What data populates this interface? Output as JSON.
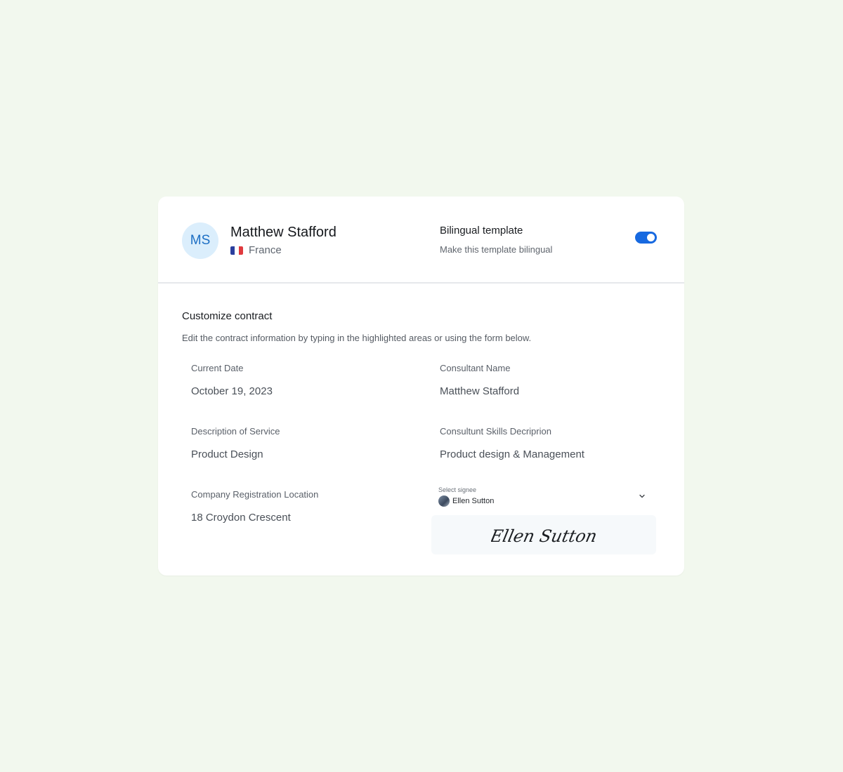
{
  "profile": {
    "initials": "MS",
    "name": "Matthew Stafford",
    "country": "France"
  },
  "bilingual": {
    "title": "Bilingual template",
    "subtitle": "Make this template bilingual",
    "enabled": true
  },
  "contract": {
    "title": "Customize contract",
    "description": "Edit the contract information by typing in the highlighted areas or using the form below.",
    "fields": {
      "current_date": {
        "label": "Current Date",
        "value": "October 19, 2023"
      },
      "consultant_name": {
        "label": "Consultant Name",
        "value": "Matthew Stafford"
      },
      "description_of_service": {
        "label": "Description of Service",
        "value": "Product Design"
      },
      "skills": {
        "label": "Consultunt Skills Decriprion",
        "value": "Product design & Management"
      },
      "registration_location": {
        "label": "Company Registration Location",
        "value": "18 Croydon Crescent"
      }
    },
    "signee": {
      "label": "Select signee",
      "name": "Ellen Sutton",
      "signature_text": "Ellen Sutton"
    }
  },
  "colors": {
    "background": "#f2f8ee",
    "accent": "#1769e0",
    "avatar_bg": "#dbeefc",
    "avatar_text": "#1d6fc4"
  },
  "icons": {
    "flag": "france-flag-icon",
    "dropdown": "chevron-down-icon",
    "signee_avatar": "avatar-icon"
  }
}
